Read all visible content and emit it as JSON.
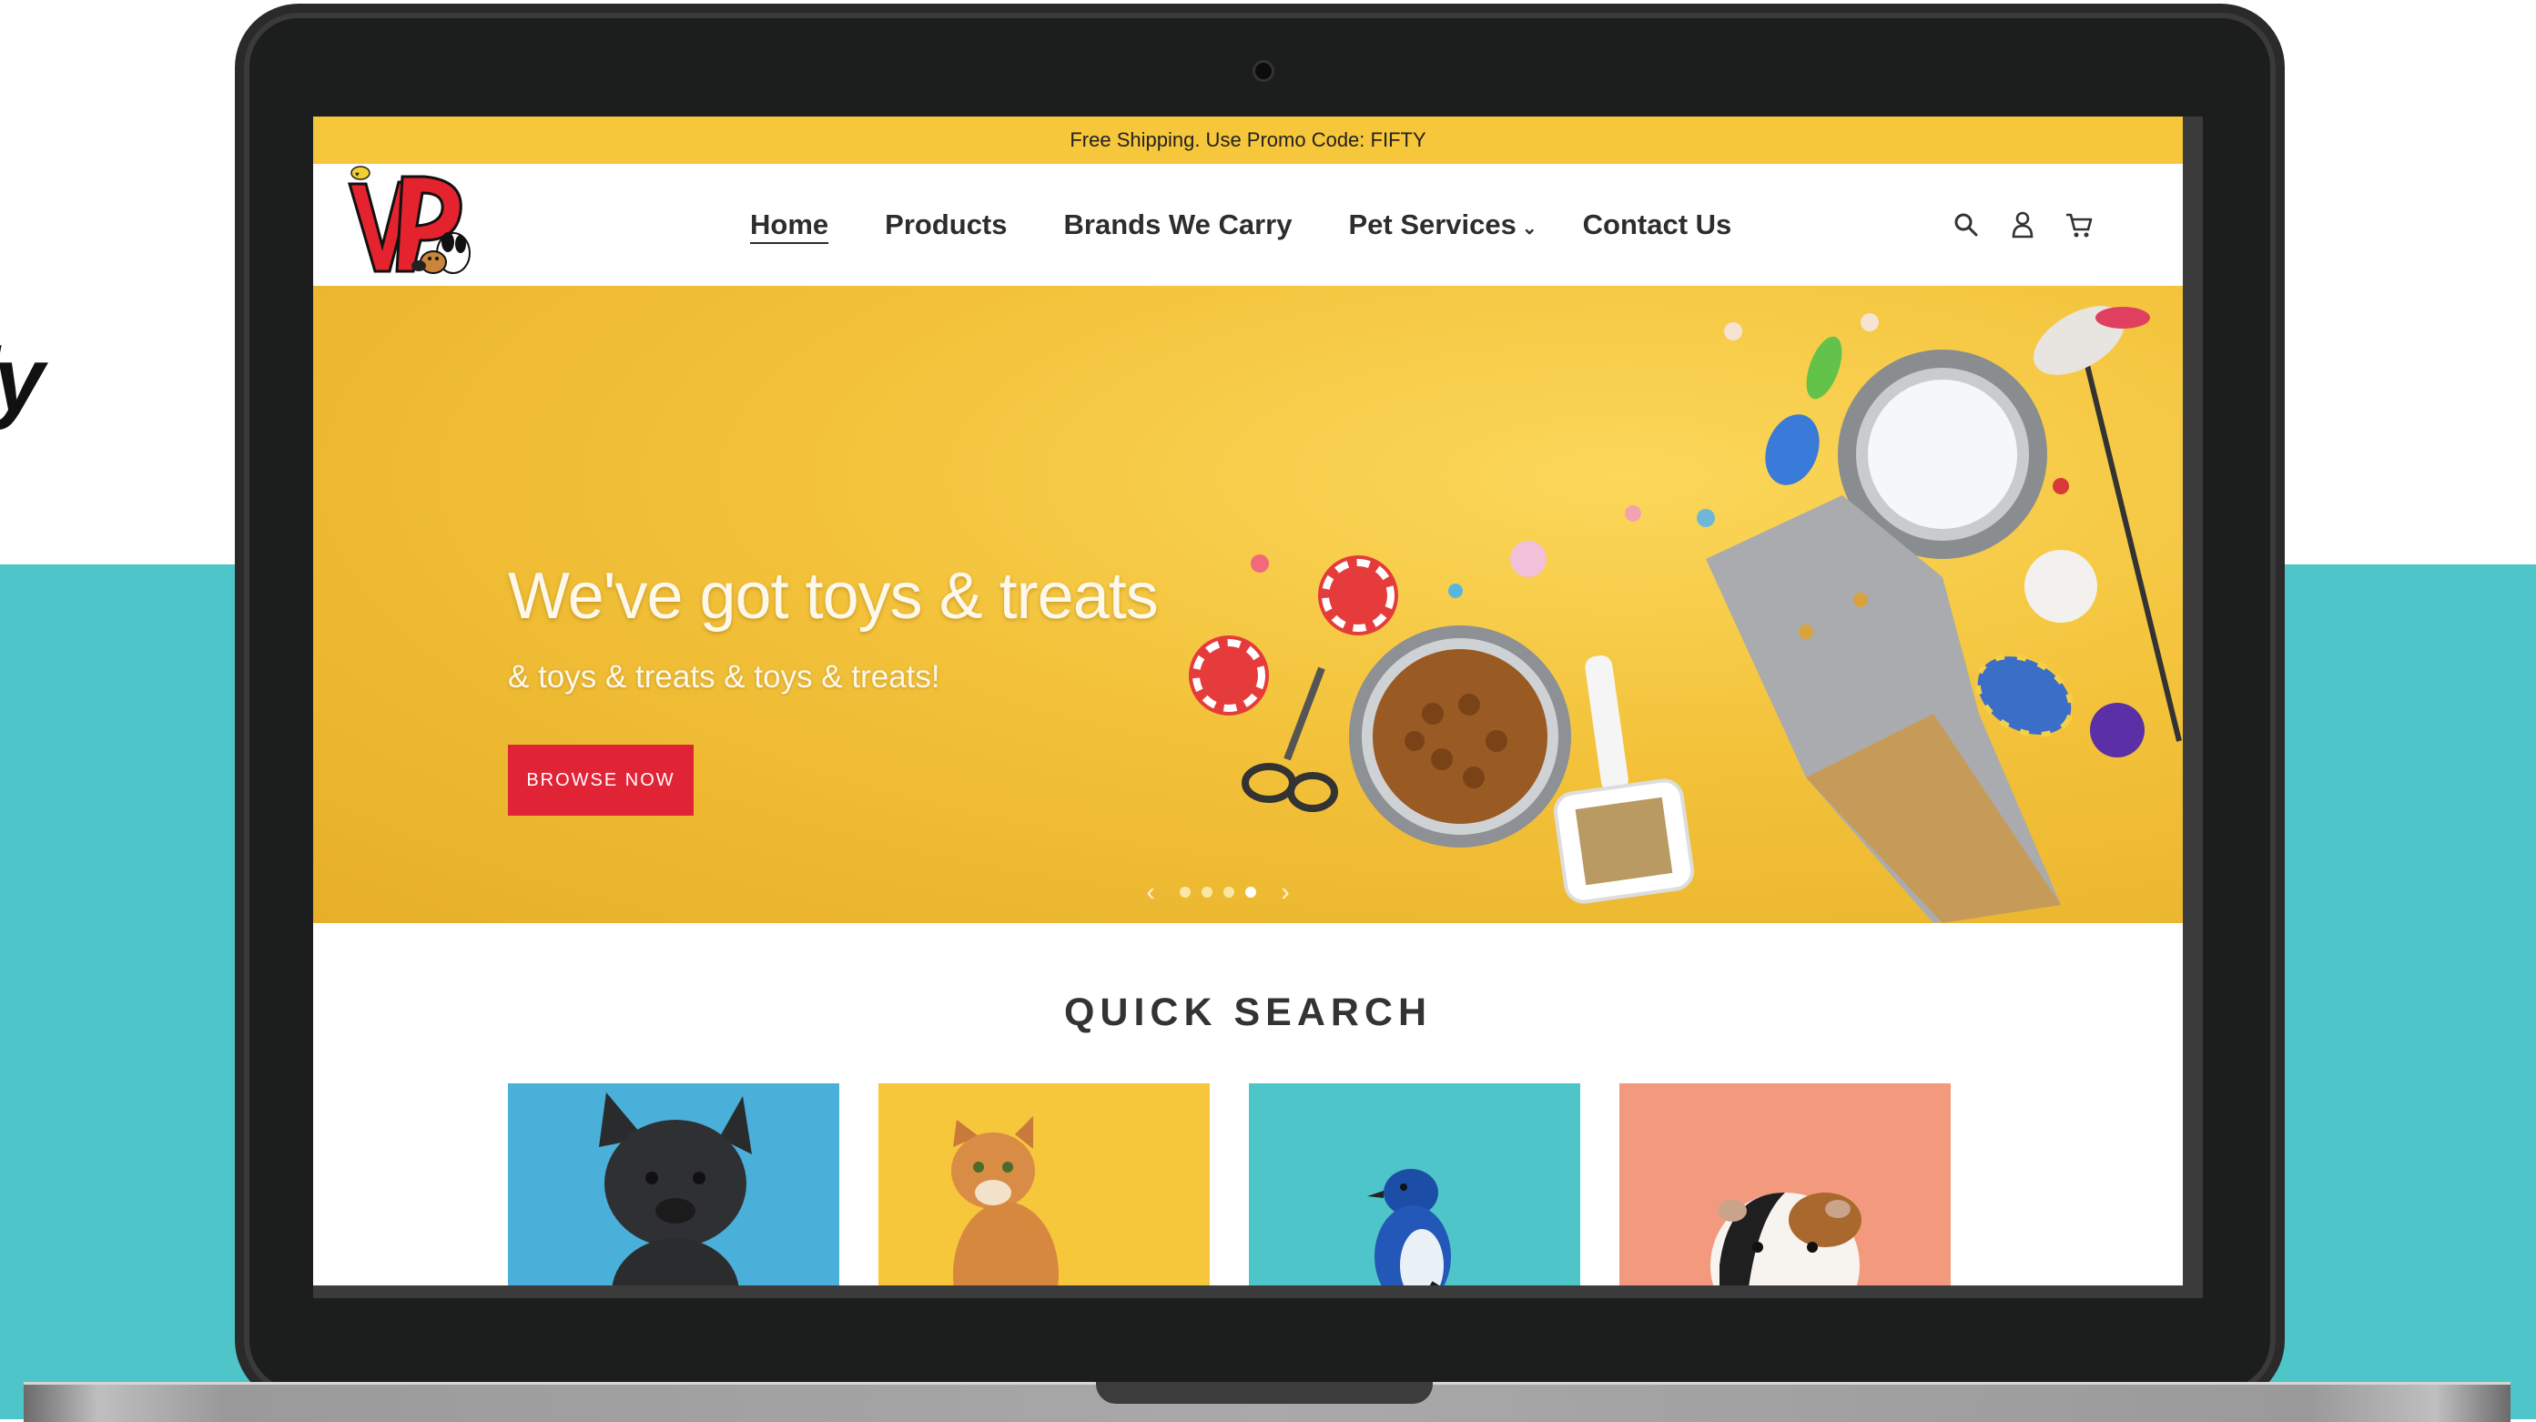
{
  "side_text": "fy",
  "promo": {
    "text": "Free Shipping. Use Promo Code: FIFTY"
  },
  "nav": {
    "items": [
      {
        "label": "Home"
      },
      {
        "label": "Products"
      },
      {
        "label": "Brands We Carry"
      },
      {
        "label": "Pet Services"
      },
      {
        "label": "Contact Us"
      }
    ],
    "dropdown_caret": "⌄"
  },
  "header_icons": [
    "search-icon",
    "account-icon",
    "cart-icon"
  ],
  "hero": {
    "title": "We've got toys & treats",
    "subtitle": "& toys & treats & toys & treats!",
    "button_label": "BROWSE NOW",
    "slide_count": 4,
    "active_slide": 4,
    "prev_arrow": "‹",
    "next_arrow": "›"
  },
  "quick_search": {
    "title": "QUICK SEARCH",
    "cards": [
      {
        "animal": "dog",
        "color": "#4aafd9"
      },
      {
        "animal": "cat",
        "color": "#f6c63b"
      },
      {
        "animal": "bird",
        "color": "#4ec5c8"
      },
      {
        "animal": "small-pet",
        "color": "#f39a7e"
      }
    ]
  },
  "colors": {
    "promo_bar": "#f6c63b",
    "accent_red": "#e12336",
    "teal": "#4ec5c8"
  }
}
